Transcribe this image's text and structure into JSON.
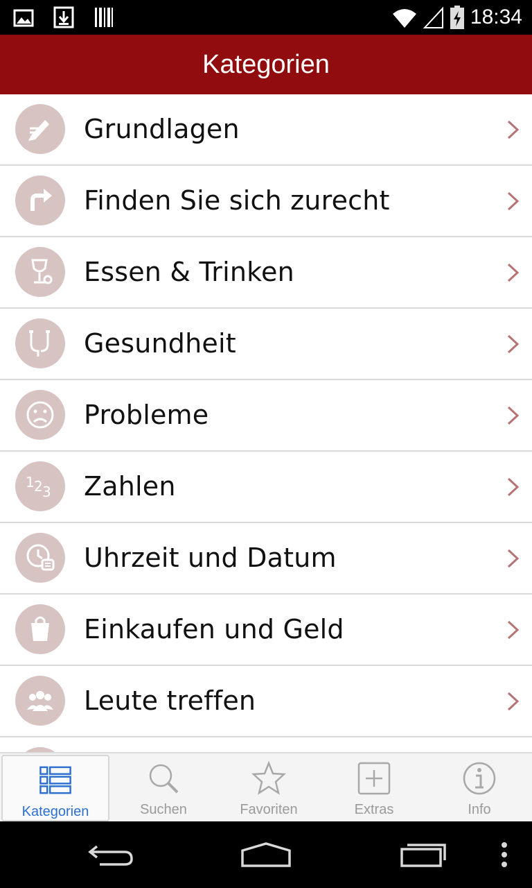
{
  "status_bar": {
    "time": "18:34",
    "left_icons": [
      "image-icon",
      "download-icon",
      "barcode-icon"
    ],
    "right_icons": [
      "wifi-icon",
      "signal-icon",
      "battery-icon"
    ]
  },
  "header": {
    "title": "Kategorien"
  },
  "categories": [
    {
      "label": "Grundlagen",
      "icon": "pencil-icon"
    },
    {
      "label": "Finden Sie sich zurecht",
      "icon": "turn-arrow-icon"
    },
    {
      "label": "Essen & Trinken",
      "icon": "glass-icon"
    },
    {
      "label": "Gesundheit",
      "icon": "stethoscope-icon"
    },
    {
      "label": "Probleme",
      "icon": "sad-face-icon"
    },
    {
      "label": "Zahlen",
      "icon": "numbers-icon"
    },
    {
      "label": "Uhrzeit und Datum",
      "icon": "clock-icon"
    },
    {
      "label": "Einkaufen und Geld",
      "icon": "shopping-bag-icon"
    },
    {
      "label": "Leute treffen",
      "icon": "people-icon"
    }
  ],
  "tabs": [
    {
      "label": "Kategorien",
      "icon": "list-icon",
      "active": true
    },
    {
      "label": "Suchen",
      "icon": "search-icon",
      "active": false
    },
    {
      "label": "Favoriten",
      "icon": "star-icon",
      "active": false
    },
    {
      "label": "Extras",
      "icon": "plus-box-icon",
      "active": false
    },
    {
      "label": "Info",
      "icon": "info-icon",
      "active": false
    }
  ],
  "colors": {
    "header": "#900c0e",
    "icon_circle": "#d8c3c3",
    "chevron": "#b57474",
    "tab_active": "#2c6fd1",
    "tab_inactive": "#9a9a9a"
  }
}
